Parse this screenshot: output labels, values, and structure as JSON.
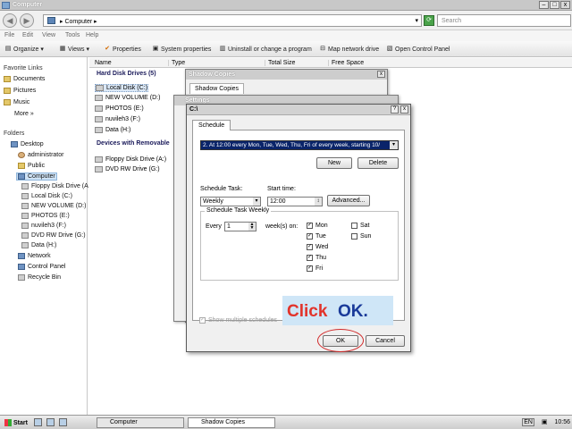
{
  "window": {
    "title": "Computer"
  },
  "address": {
    "crumb": "▸ Computer ▸",
    "search_placeholder": "Search"
  },
  "menu": [
    "File",
    "Edit",
    "View",
    "Tools",
    "Help"
  ],
  "toolbar": [
    "Organize ▾",
    "Views ▾",
    "Properties",
    "System properties",
    "Uninstall or change a program",
    "Map network drive",
    "Open Control Panel"
  ],
  "nav": {
    "favorites_header": "Favorite Links",
    "favorites": [
      "Documents",
      "Pictures",
      "Music",
      "More »"
    ],
    "folders_header": "Folders",
    "tree": [
      "Desktop",
      "administrator",
      "Public",
      "Computer",
      "Floppy Disk Drive (A",
      "Local Disk (C:)",
      "NEW VOLUME (D:)",
      "PHOTOS (E:)",
      "nuvileh3 (F:)",
      "DVD RW Drive (G:)",
      "Data (H:)",
      "Network",
      "Control Panel",
      "Recycle Bin"
    ]
  },
  "columns": [
    "Name",
    "Type",
    "Total Size",
    "Free Space"
  ],
  "content": {
    "group_hdd": "Hard Disk Drives (5)",
    "drives": [
      "Local Disk (C:)",
      "NEW VOLUME (D:)",
      "PHOTOS (E:)",
      "nuvileh3 (F:)",
      "Data (H:)"
    ],
    "group_removable": "Devices with Removable",
    "removable": [
      "Floppy Disk Drive (A:)",
      "DVD RW Drive (G:)"
    ]
  },
  "shadow_window": {
    "title": "Shadow Copies",
    "tab": "Shadow Copies"
  },
  "settings_window": {
    "title": "Settings"
  },
  "dialog": {
    "title": "C:\\",
    "help": "?",
    "close": "x",
    "tab": "Schedule",
    "schedule_item": "2. At 12:00 every Mon, Tue, Wed, Thu, Fri of every week, starting 10/",
    "new_button": "New",
    "delete_button": "Delete",
    "schedule_task_label": "Schedule Task:",
    "schedule_task_value": "Weekly",
    "start_time_label": "Start time:",
    "start_time_value": "12:00",
    "advanced_button": "Advanced...",
    "group_label": "Schedule Task Weekly",
    "every_label": "Every",
    "every_value": "1",
    "weeks_on_label": "week(s) on:",
    "days": [
      {
        "label": "Mon",
        "checked": true
      },
      {
        "label": "Tue",
        "checked": true
      },
      {
        "label": "Wed",
        "checked": true
      },
      {
        "label": "Thu",
        "checked": true
      },
      {
        "label": "Fri",
        "checked": true
      },
      {
        "label": "Sat",
        "checked": false
      },
      {
        "label": "Sun",
        "checked": false
      }
    ],
    "show_multiple_label": "Show multiple schedules",
    "ok_button": "OK",
    "cancel_button": "Cancel"
  },
  "callout": {
    "click": "Click",
    "ok": "OK."
  },
  "taskbar": {
    "start": "Start",
    "items": [
      "Computer",
      "Shadow Copies"
    ],
    "tray_lang": "EN",
    "clock": "10:56"
  }
}
